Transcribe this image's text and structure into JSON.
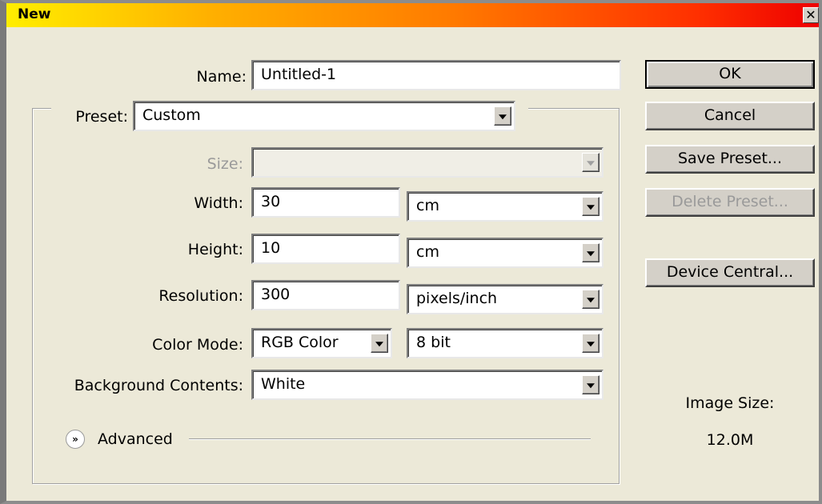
{
  "window": {
    "title": "New",
    "close_label": "✕"
  },
  "form": {
    "name": {
      "label": "Name:",
      "value": "Untitled-1"
    },
    "preset": {
      "label": "Preset:",
      "value": "Custom"
    },
    "size": {
      "label": "Size:",
      "value": ""
    },
    "width": {
      "label": "Width:",
      "value": "30",
      "unit": "cm"
    },
    "height": {
      "label": "Height:",
      "value": "10",
      "unit": "cm"
    },
    "resolution": {
      "label": "Resolution:",
      "value": "300",
      "unit": "pixels/inch"
    },
    "color_mode": {
      "label": "Color Mode:",
      "value": "RGB Color",
      "depth": "8 bit"
    },
    "background": {
      "label": "Background Contents:",
      "value": "White"
    },
    "advanced": {
      "label": "Advanced"
    }
  },
  "buttons": {
    "ok": "OK",
    "cancel": "Cancel",
    "save_preset": "Save Preset...",
    "delete_preset": "Delete Preset...",
    "device_central": "Device Central..."
  },
  "info": {
    "image_size_label": "Image Size:",
    "image_size_value": "12.0M"
  },
  "colors": {
    "title_gradient_start": "#ffee00",
    "title_gradient_end": "#ee0000",
    "dialog_bg": "#ece9d8"
  }
}
